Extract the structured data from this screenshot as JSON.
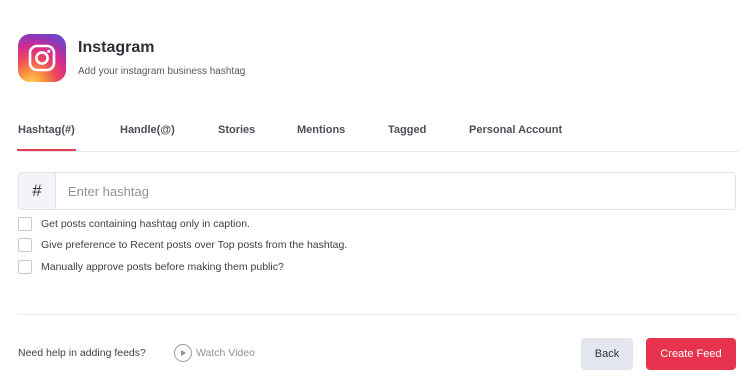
{
  "header": {
    "title": "Instagram",
    "subtitle": "Add your instagram business hashtag",
    "logo_icon": "instagram-logo-icon"
  },
  "tabs": [
    {
      "label": "Hashtag(#)",
      "active": true
    },
    {
      "label": "Handle(@)",
      "active": false
    },
    {
      "label": "Stories",
      "active": false
    },
    {
      "label": "Mentions",
      "active": false
    },
    {
      "label": "Tagged",
      "active": false
    },
    {
      "label": "Personal Account",
      "active": false
    }
  ],
  "hashtag_input": {
    "prefix": "#",
    "placeholder": "Enter hashtag",
    "value": ""
  },
  "options": [
    {
      "label": "Get posts containing hashtag only in caption.",
      "checked": false
    },
    {
      "label": "Give preference to Recent posts over Top posts from the hashtag.",
      "checked": false
    },
    {
      "label": "Manually approve posts before making them public?",
      "checked": false
    }
  ],
  "footer": {
    "help_text": "Need help in adding feeds?",
    "watch_video": "Watch Video",
    "back_label": "Back",
    "create_label": "Create Feed"
  },
  "colors": {
    "accent": "#e8334e",
    "back_button": "#e4e6ee"
  }
}
